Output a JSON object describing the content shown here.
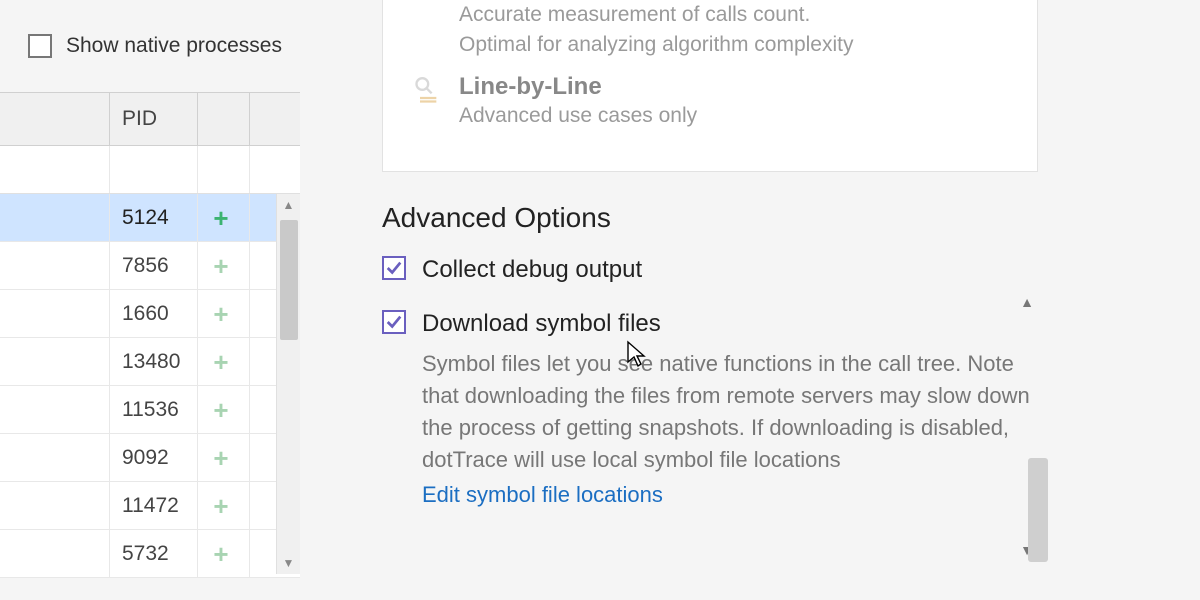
{
  "colors": {
    "accent": "#6a5fbf",
    "link": "#1b6ec2",
    "selection": "#cfe4ff"
  },
  "left": {
    "show_native_label": "Show native processes",
    "show_native_checked": false,
    "columns": {
      "pid": "PID"
    },
    "rows": [
      {
        "pid": "5124",
        "selected": true,
        "add_state": "green"
      },
      {
        "pid": "7856",
        "selected": false,
        "add_state": "faint"
      },
      {
        "pid": "1660",
        "selected": false,
        "add_state": "faint"
      },
      {
        "pid": "13480",
        "selected": false,
        "add_state": "faint"
      },
      {
        "pid": "11536",
        "selected": false,
        "add_state": "faint"
      },
      {
        "pid": "9092",
        "selected": false,
        "add_state": "faint"
      },
      {
        "pid": "11472",
        "selected": false,
        "add_state": "faint"
      },
      {
        "pid": "5732",
        "selected": false,
        "add_state": "faint"
      }
    ]
  },
  "profiling_modes": {
    "tracing": {
      "title": "",
      "line1": "Accurate measurement of calls count.",
      "line2": "Optimal for analyzing algorithm complexity"
    },
    "line_by_line": {
      "title": "Line-by-Line",
      "desc": "Advanced use cases only"
    }
  },
  "advanced": {
    "section_title": "Advanced Options",
    "collect_debug": {
      "label": "Collect debug output",
      "checked": true
    },
    "download_symbols": {
      "label": "Download symbol files",
      "checked": true,
      "desc": "Symbol files let you see native functions in the call tree. Note that downloading the files from remote servers may slow down the process of getting snapshots. If downloading is disabled, dotTrace will use local symbol file locations",
      "link": "Edit symbol file locations"
    }
  }
}
